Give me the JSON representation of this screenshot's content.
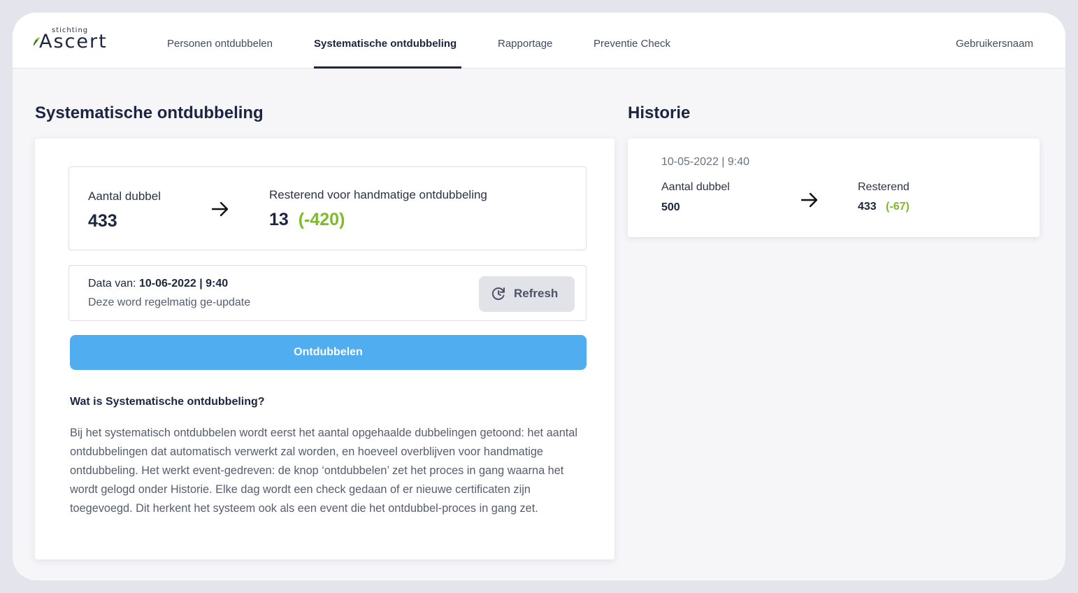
{
  "header": {
    "logo_small": "stichting",
    "logo_main": "Ascert",
    "nav": [
      {
        "label": "Personen ontdubbelen"
      },
      {
        "label": "Systematische ontdubbeling"
      },
      {
        "label": "Rapportage"
      },
      {
        "label": "Preventie Check"
      }
    ],
    "active_nav": "Systematische ontdubbeling",
    "username": "Gebruikersnaam"
  },
  "main": {
    "title": "Systematische ontdubbeling",
    "stats": {
      "left_label": "Aantal dubbel",
      "left_value": "433",
      "right_label": "Resterend voor handmatige ontdubbeling",
      "right_value": "13",
      "right_delta": "(-420)"
    },
    "data": {
      "prefix": "Data van: ",
      "date": "10-06-2022 | 9:40",
      "note": "Deze word regelmatig ge-update",
      "refresh_label": "Refresh"
    },
    "primary_button": "Ontdubbelen",
    "info": {
      "title": "Wat is Systematische ontdubbeling?",
      "body": "Bij het systematisch ontdubbelen wordt eerst het aantal opgehaalde dubbelingen getoond: het aantal ontdubbelingen dat automatisch verwerkt zal worden, en hoeveel overblijven voor handmatige ontdubbeling. Het werkt event-gedreven: de knop ‘ontdubbelen’ zet het proces in gang waarna het wordt gelogd onder Historie. Elke dag wordt een check gedaan of er nieuwe certificaten zijn toegevoegd. Dit herkent het systeem ook als een event die het ontdubbel-proces in gang zet."
    }
  },
  "history": {
    "title": "Historie",
    "entries": [
      {
        "date": "10-05-2022 | 9:40",
        "left_label": "Aantal dubbel",
        "left_value": "500",
        "right_label": "Resterend",
        "right_value": "433",
        "right_delta": "(-67)"
      }
    ]
  },
  "colors": {
    "navy": "#1c2541",
    "accent_blue": "#4fadf0",
    "delta_green": "#7dbb2d",
    "logo_leaf_green": "#7dbb2d"
  },
  "icons": [
    "leaf-icon",
    "arrow-right-icon",
    "refresh-icon"
  ]
}
